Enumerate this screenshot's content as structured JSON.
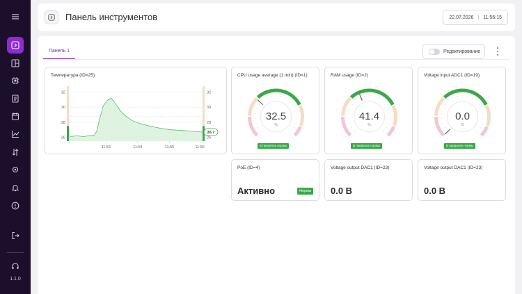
{
  "sidebar": {
    "items": [
      {
        "name": "menu-icon"
      },
      {
        "name": "dashboard-icon"
      },
      {
        "name": "layout-icon"
      },
      {
        "name": "chip-icon"
      },
      {
        "name": "document-icon"
      },
      {
        "name": "calendar-icon"
      },
      {
        "name": "chart-icon"
      },
      {
        "name": "transfer-icon"
      },
      {
        "name": "gear-icon"
      },
      {
        "name": "bell-icon"
      },
      {
        "name": "info-icon"
      },
      {
        "name": "logout-icon"
      },
      {
        "name": "headset-icon"
      }
    ],
    "version": "1.1.0"
  },
  "header": {
    "title": "Панель инструментов",
    "date": "22.07.2026",
    "time": "11:56:15"
  },
  "toolbar": {
    "tab_label": "Панель 1",
    "edit_label": "Редактирование"
  },
  "temperature": {
    "title": "Температура (ID=25)",
    "current_label": "26.7",
    "chart_data": {
      "type": "line",
      "title": "Температура (ID=25)",
      "x_ticks": [
        "11:53",
        "11:54",
        "11:55",
        "11:56"
      ],
      "y_ticks": [
        26,
        28,
        30,
        32
      ],
      "ylim": [
        25.5,
        32.5
      ],
      "points": [
        [
          0,
          26.1
        ],
        [
          0.05,
          26.2
        ],
        [
          0.1,
          26.1
        ],
        [
          0.14,
          26.2
        ],
        [
          0.18,
          26.3
        ],
        [
          0.2,
          26.8
        ],
        [
          0.22,
          28.3
        ],
        [
          0.25,
          30.2
        ],
        [
          0.28,
          30.9
        ],
        [
          0.31,
          31.2
        ],
        [
          0.34,
          30.5
        ],
        [
          0.38,
          29.5
        ],
        [
          0.42,
          28.8
        ],
        [
          0.47,
          28.2
        ],
        [
          0.53,
          27.8
        ],
        [
          0.6,
          27.5
        ],
        [
          0.68,
          27.2
        ],
        [
          0.76,
          27.0
        ],
        [
          0.85,
          26.9
        ],
        [
          0.92,
          26.8
        ],
        [
          1.0,
          26.7
        ]
      ]
    }
  },
  "gauges": [
    {
      "title": "CPU usage average (1 min) (ID=1)",
      "value": 32.5,
      "display": "32.5",
      "unit": "%",
      "status": "В пределах нормы",
      "max": 100
    },
    {
      "title": "RAM usage (ID=2)",
      "value": 41.4,
      "display": "41.4",
      "unit": "%",
      "status": "В пределах нормы",
      "max": 100
    },
    {
      "title": "Voltage input ADC1 (ID=19)",
      "value": 0,
      "display": "0.0",
      "unit": "В",
      "status": "В пределах нормы",
      "max": 100
    }
  ],
  "poe": {
    "title": "PoE (ID=4)",
    "value": "Активно",
    "status": "Норма"
  },
  "dac": [
    {
      "title": "Voltage output DAC1 (ID=23)",
      "value": "0.0 В"
    },
    {
      "title": "Voltage output DAC1 (ID=23)",
      "value": "0.0 В"
    }
  ],
  "colors": {
    "accent": "#8e2bd6",
    "ok": "#3aa84a",
    "warn": "#f6dcc4",
    "danger": "#f4c6d0"
  }
}
